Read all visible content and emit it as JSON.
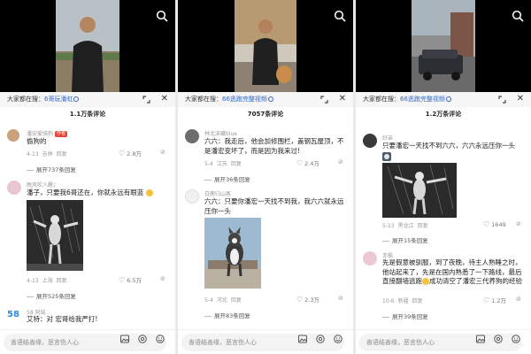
{
  "search_prefix": "大家都在搜：",
  "input_placeholder": "善语结善缘，恶言伤人心",
  "panels": [
    {
      "search_term": "6哥玩潘虹",
      "comment_count": "1.1万条评论",
      "comments": [
        {
          "username": "潘宏爱骑狗",
          "author_tag": "作者",
          "text": "偷狗的",
          "date": "4-13",
          "location": "吉林",
          "reply": "回复",
          "likes": "2.8万",
          "replies": "展开737条回复"
        },
        {
          "username": "晚风吹人醒♪",
          "text": "潘子，只要我6哥还在，你就永远有眼蓝",
          "date": "4-13",
          "location": "上海",
          "reply": "回复",
          "likes": "6.5万",
          "replies": "展开525条回复"
        },
        {
          "username": "58 同城",
          "text": "艾特：对 宏哥给我严打!"
        }
      ]
    },
    {
      "search_term": "66逃跑完整视频",
      "comment_count": "7057条评论",
      "comments": [
        {
          "username": "林北深藏blue",
          "text": "六六：我走后，他会加修围栏，盖钢瓦屋顶，不是潘宏变坏了，而是因为我来过!",
          "date": "5-4",
          "location": "江苏",
          "reply": "回复",
          "likes": "2.4万",
          "replies": "展开36条回复"
        },
        {
          "username": "白鹿归山客",
          "text": "六六：只要你潘宏一天找不到我，我六六就永远压你一头",
          "date": "5-4",
          "location": "河北",
          "reply": "回复",
          "likes": "2.3万",
          "replies": "展开83条回复"
        }
      ]
    },
    {
      "search_term": "66逃跑完整视频",
      "comment_count": "1.2万条评论",
      "comments": [
        {
          "username": "好弟",
          "text": "只要潘宏一天找不到六六，六六永远压你一头",
          "date": "5-13",
          "location": "黑龙江",
          "reply": "回复",
          "likes": "1649",
          "replies": "展开15条回复"
        },
        {
          "username": "赤枫",
          "text": "先是假意被驯服，到了夜晚，待主人熟睡之时，他站起来了，先是在国内熟悉了一下路线，最后直接翻墙逃跑",
          "text_tail": "成功清空了潘宏三代养狗的经验",
          "date": "10-6",
          "location": "新疆",
          "reply": "回复",
          "likes": "1.2万",
          "replies": "展开39条回复"
        }
      ]
    }
  ],
  "icons": {
    "top_right": "search-icon",
    "bar": [
      "expand-icon",
      "close-icon"
    ],
    "likes": "heart-icon",
    "dislike": "thumbs-down-icon",
    "input": [
      "image-icon",
      "at-icon",
      "emoji-icon"
    ]
  },
  "colors": {
    "link": "#2f66c7",
    "author_tag": "#e8453c"
  }
}
